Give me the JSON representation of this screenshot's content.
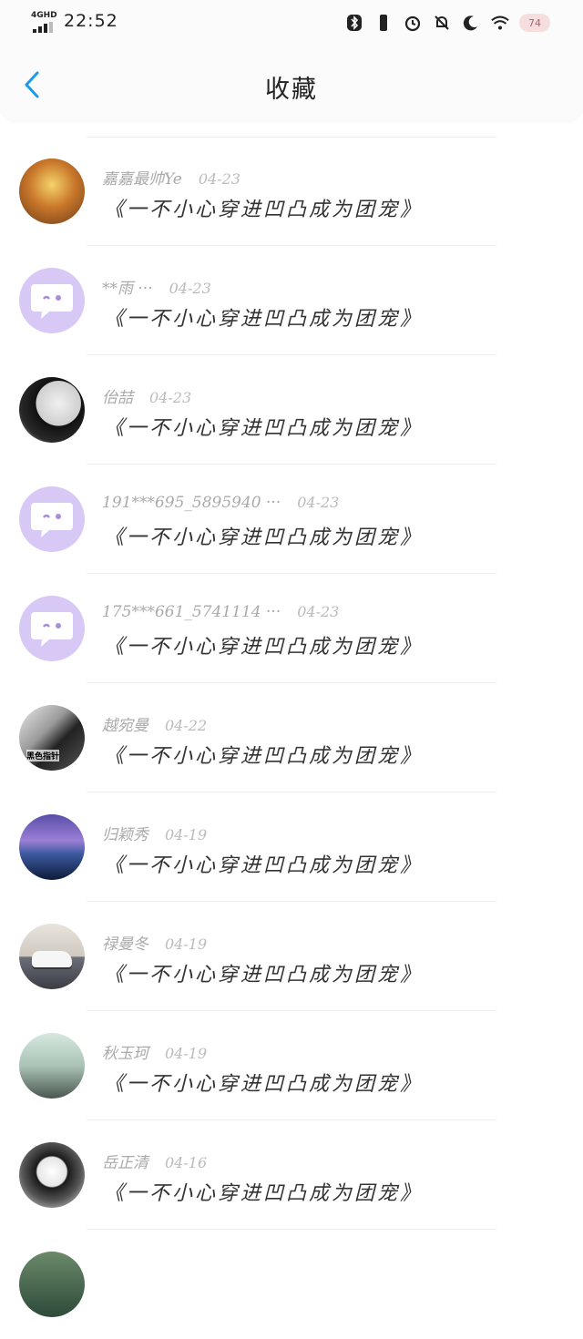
{
  "status_bar": {
    "network": "4GHD",
    "time": "22:52",
    "battery": "74"
  },
  "header": {
    "title": "收藏"
  },
  "items": [
    {
      "name": "嘉嘉最帅Ye",
      "date": "04-23",
      "book": "《一不小心穿进凹凸成为团宠》",
      "avatar": "game-avatar"
    },
    {
      "name": "**雨 ···",
      "date": "04-23",
      "book": "《一不小心穿进凹凸成为团宠》",
      "avatar": "default-chat-avatar"
    },
    {
      "name": "佁喆",
      "date": "04-23",
      "book": "《一不小心穿进凹凸成为团宠》",
      "avatar": "anime-avatar"
    },
    {
      "name": "191***695_5895940 ···",
      "date": "04-23",
      "book": "《一不小心穿进凹凸成为团宠》",
      "avatar": "default-chat-avatar"
    },
    {
      "name": "175***661_5741114 ···",
      "date": "04-23",
      "book": "《一不小心穿进凹凸成为团宠》",
      "avatar": "default-chat-avatar"
    },
    {
      "name": "越宛曼",
      "date": "04-22",
      "book": "《一不小心穿进凹凸成为团宠》",
      "avatar": "man-avatar",
      "avatar_text": "黑色指针"
    },
    {
      "name": "归颖秀",
      "date": "04-19",
      "book": "《一不小心穿进凹凸成为团宠》",
      "avatar": "sea-avatar"
    },
    {
      "name": "禄曼冬",
      "date": "04-19",
      "book": "《一不小心穿进凹凸成为团宠》",
      "avatar": "car-avatar"
    },
    {
      "name": "秋玉珂",
      "date": "04-19",
      "book": "《一不小心穿进凹凸成为团宠》",
      "avatar": "mist-avatar"
    },
    {
      "name": "岳正清",
      "date": "04-16",
      "book": "《一不小心穿进凹凸成为团宠》",
      "avatar": "girl-avatar"
    }
  ],
  "colors": {
    "back_arrow": "#1a9bf0",
    "chat_avatar_bg": "#d8c8f5"
  }
}
